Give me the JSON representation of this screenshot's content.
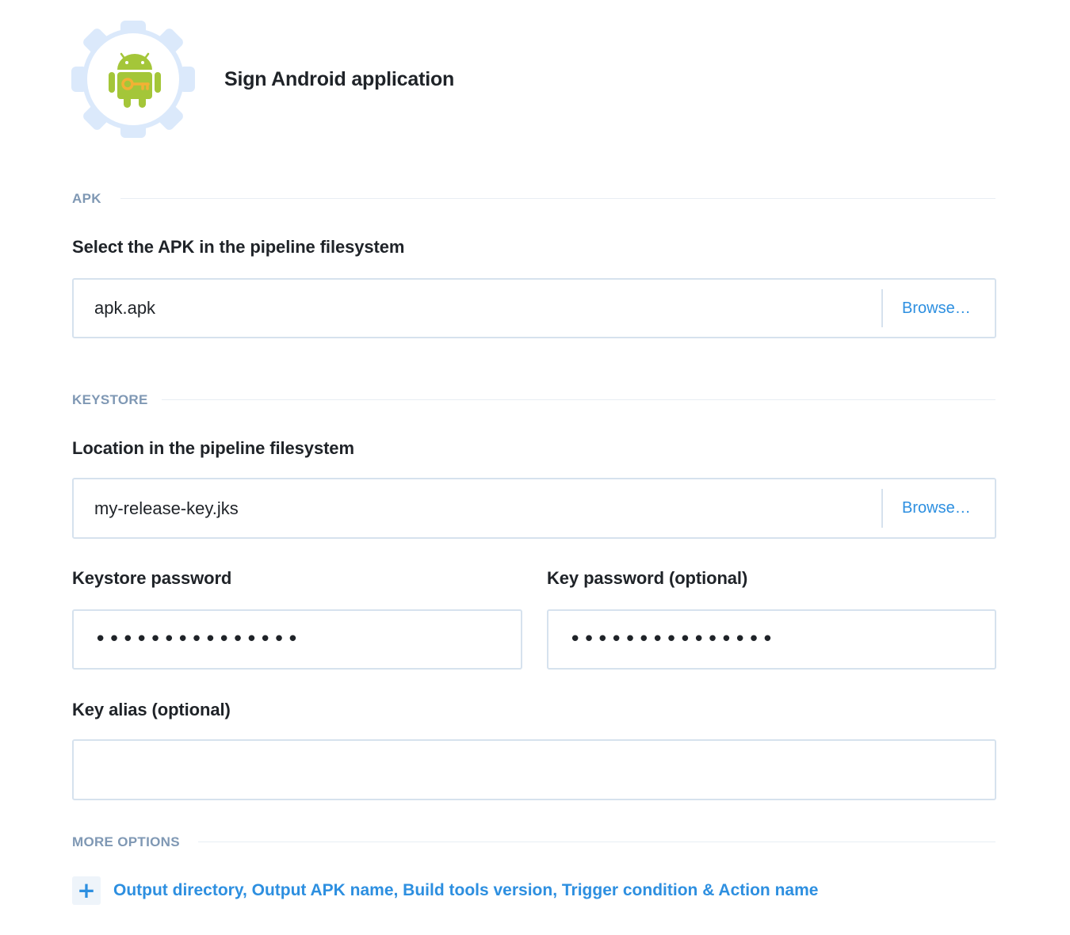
{
  "header": {
    "title": "Sign Android application",
    "icon": "android-key-gear-icon"
  },
  "apk_section": {
    "label": "APK",
    "field_label": "Select the APK in the pipeline filesystem",
    "value": "apk.apk",
    "browse_label": "Browse…"
  },
  "keystore_section": {
    "label": "KEYSTORE",
    "location_label": "Location in the pipeline filesystem",
    "location_value": "my-release-key.jks",
    "browse_label": "Browse…",
    "keystore_password_label": "Keystore password",
    "keystore_password_value": "•••••••••••••••",
    "key_password_label": "Key password (optional)",
    "key_password_value": "•••••••••••••••",
    "key_alias_label": "Key alias (optional)",
    "key_alias_value": ""
  },
  "more_options": {
    "label": "MORE OPTIONS",
    "expand_icon": "+",
    "link_text": "Output directory, Output APK name, Build tools version, Trigger condition & Action name"
  },
  "colors": {
    "accent": "#2d8fe0",
    "section_label": "#7f98b4",
    "input_border": "#d6e2ee",
    "android_green": "#a4c639",
    "key_gold": "#f2b134",
    "gear_fill": "#dbe9fb"
  }
}
